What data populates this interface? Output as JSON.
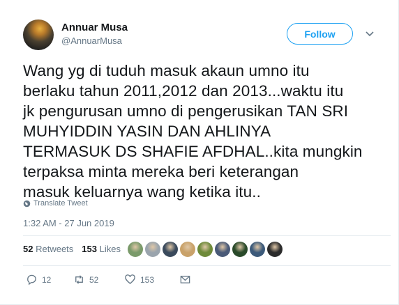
{
  "user": {
    "name": "Annuar Musa",
    "handle": "@AnnuarMusa"
  },
  "follow_label": "Follow",
  "tweet": {
    "lines": [
      "Wang yg di tuduh masuk akaun umno itu",
      "berlaku tahun 2011,2012 dan 2013...waktu itu",
      "jk pengurusan umno di pengerusikan TAN SRI",
      "MUHYIDDIN YASIN DAN AHLINYA",
      "TERMASUK DS SHAFIE AFDHAL..kita mungkin",
      "terpaksa minta mereka beri keterangan",
      "masuk keluarnya wang ketika itu.."
    ]
  },
  "translate_label": "Translate Tweet",
  "timestamp": "1:32 AM - 27 Jun 2019",
  "stats": {
    "retweets_count": "52",
    "retweets_label": "Retweets",
    "likes_count": "153",
    "likes_label": "Likes"
  },
  "likers": [
    {
      "color": "#7a9a6a"
    },
    {
      "color": "#9aa4ad"
    },
    {
      "color": "#3a4a5c"
    },
    {
      "color": "#c9a26a"
    },
    {
      "color": "#6e8a3a"
    },
    {
      "color": "#4a5a78"
    },
    {
      "color": "#2a4a2a"
    },
    {
      "color": "#3c5a7a"
    },
    {
      "color": "#2b2b2b"
    }
  ],
  "actions": {
    "replies": "12",
    "retweets": "52",
    "likes": "153"
  },
  "colors": {
    "accent": "#1da1f2",
    "muted": "#657786",
    "text": "#14171a",
    "divider": "#e6ecf0"
  }
}
